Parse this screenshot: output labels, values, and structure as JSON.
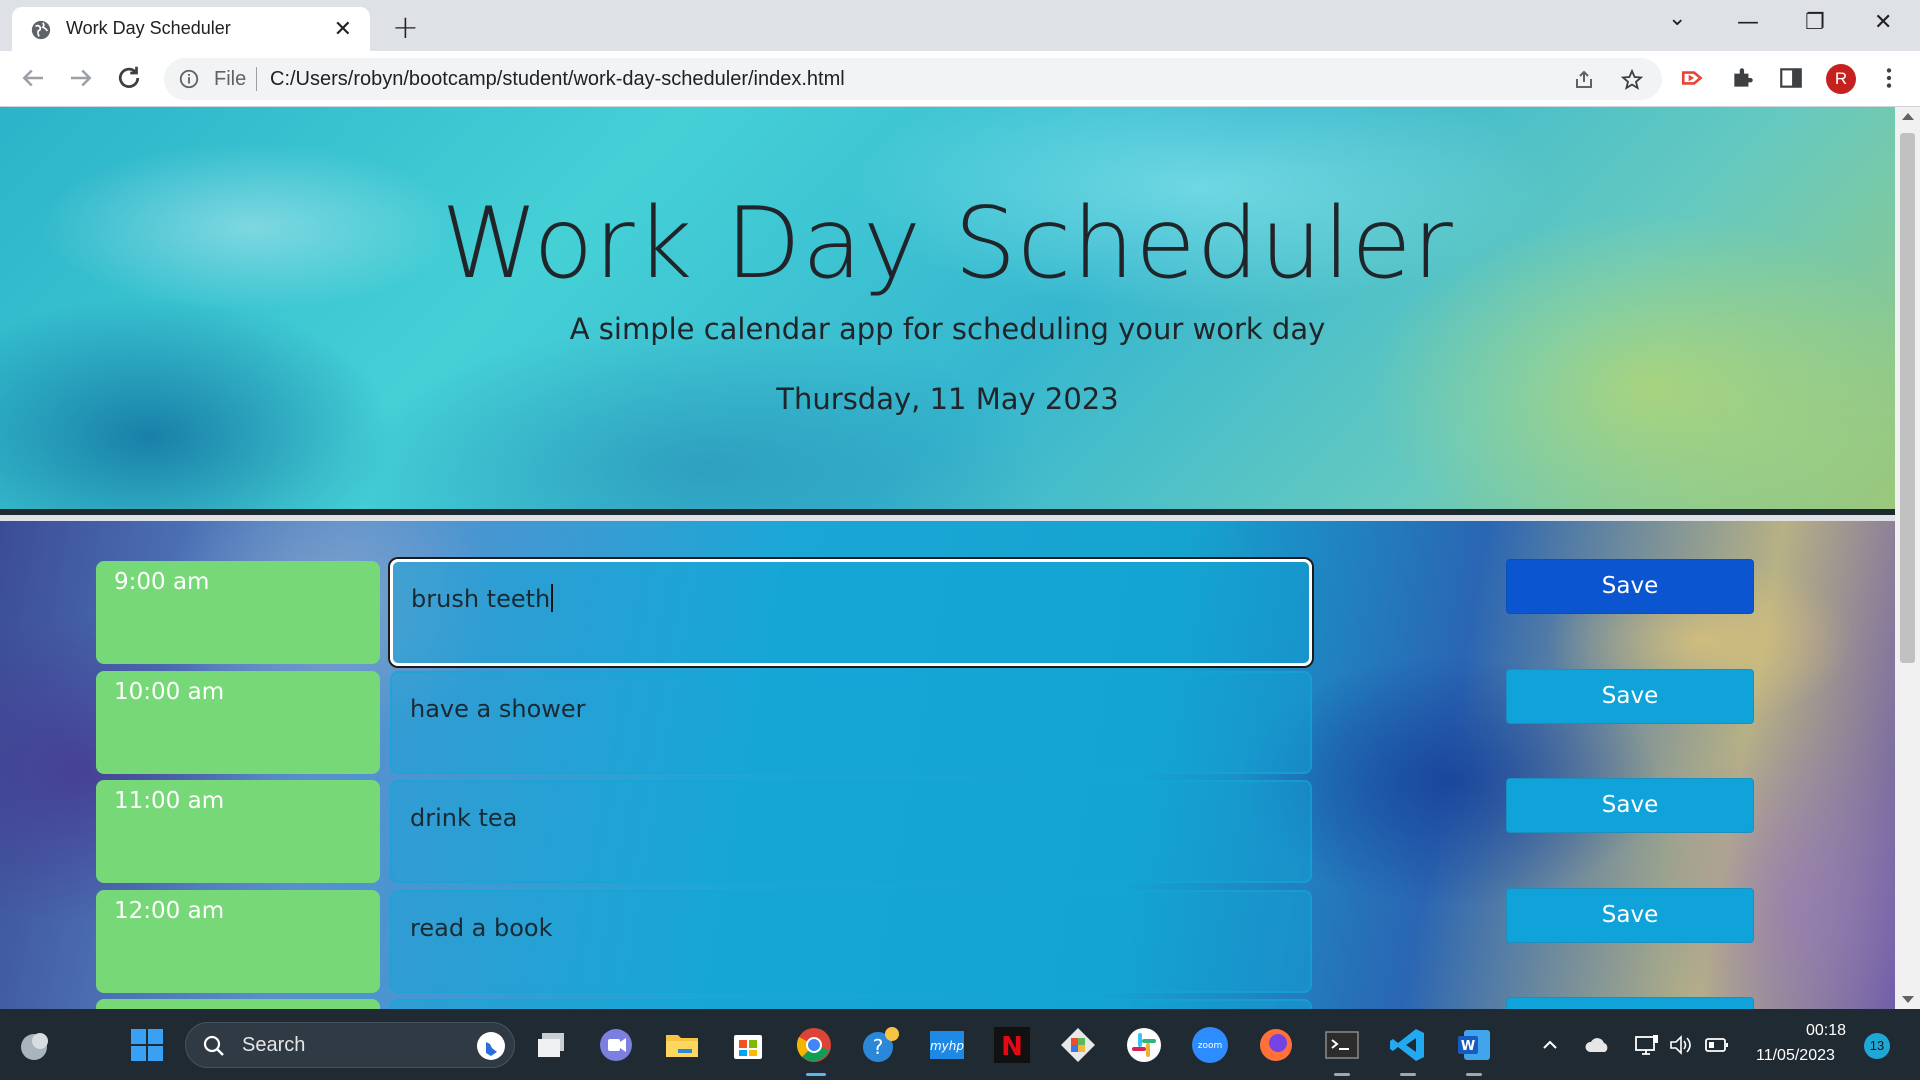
{
  "browser": {
    "tab_title": "Work Day Scheduler",
    "tab_close": "✕",
    "new_tab": "+",
    "address_prefix": "File",
    "url": "C:/Users/robyn/bootcamp/student/work-day-scheduler/index.html",
    "profile_initial": "R",
    "window_controls": {
      "dropdown": "⌄",
      "minimize": "—",
      "restore": "❐",
      "close": "✕"
    }
  },
  "page": {
    "title": "Work Day Scheduler",
    "subtitle": "A simple calendar app for scheduling your work day",
    "date": "Thursday, 11 May 2023"
  },
  "schedule": [
    {
      "time": "9:00 am",
      "task": "brush teeth",
      "save": "Save"
    },
    {
      "time": "10:00 am",
      "task": "have a shower",
      "save": "Save"
    },
    {
      "time": "11:00 am",
      "task": "drink tea",
      "save": "Save"
    },
    {
      "time": "12:00 am",
      "task": "read a book",
      "save": "Save"
    }
  ],
  "colors": {
    "time_block": "#77d877",
    "save_button": "#0fa3d9",
    "save_button_active": "#0b55d1"
  },
  "taskbar": {
    "search_label": "Search",
    "time": "00:18",
    "date": "11/05/2023",
    "notification_count": "13",
    "apps": [
      "widgets-icon",
      "windows-start-icon",
      "bing-icon",
      "task-view-icon",
      "teams-chat-icon",
      "file-explorer-icon",
      "microsoft-store-icon",
      "chrome-icon",
      "get-help-icon",
      "myhp-icon",
      "netflix-icon",
      "git-icon",
      "slack-icon",
      "zoom-icon",
      "firefox-icon",
      "terminal-icon",
      "vscode-icon",
      "word-icon"
    ],
    "myhp_label": "myhp",
    "netflix_label": "N",
    "zoom_label": "zoom",
    "word_label": "W"
  }
}
